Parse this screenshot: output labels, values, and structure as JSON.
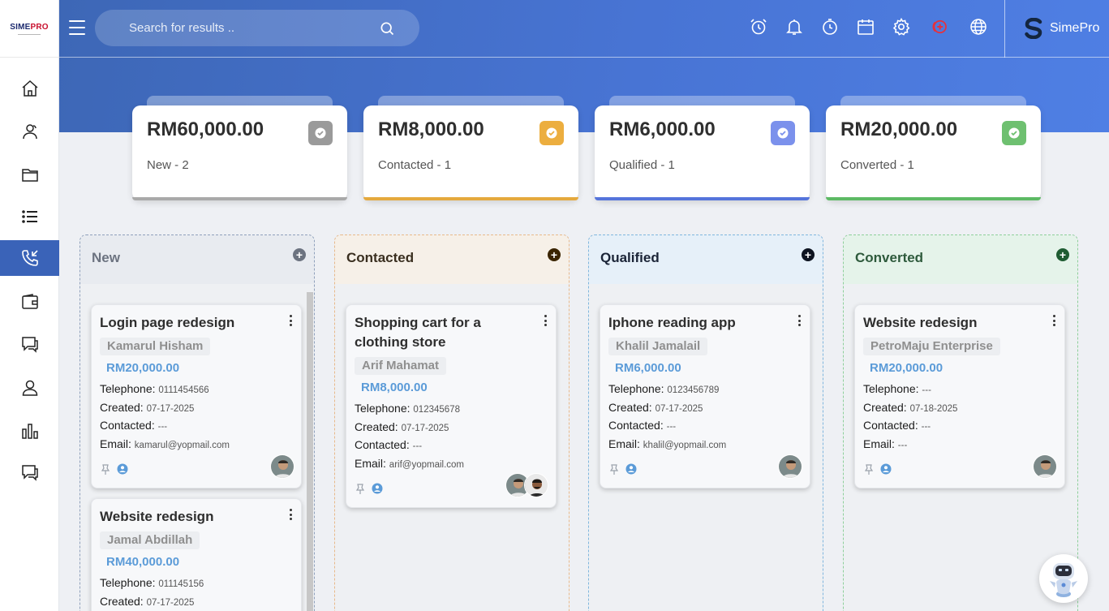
{
  "logo": {
    "text_a": "SIME",
    "text_b": "PRO"
  },
  "search": {
    "placeholder": "Search for results .."
  },
  "user": {
    "name": "SimePro"
  },
  "summary": [
    {
      "amount": "RM60,000.00",
      "label": "New - 2",
      "color": "#a9a9a9",
      "badge": "#9a9a9a"
    },
    {
      "amount": "RM8,000.00",
      "label": "Contacted - 1",
      "color": "#e5a93d",
      "badge": "#ecae3f"
    },
    {
      "amount": "RM6,000.00",
      "label": "Qualified - 1",
      "color": "#5574db",
      "badge": "#7b91ec"
    },
    {
      "amount": "RM20,000.00",
      "label": "Converted - 1",
      "color": "#5dba64",
      "badge": "#6ec070"
    }
  ],
  "columns": [
    {
      "title": "New",
      "title_color": "#6c7380"
    },
    {
      "title": "Contacted",
      "title_color": "#3a2f20"
    },
    {
      "title": "Qualified",
      "title_color": "#1b2437"
    },
    {
      "title": "Converted",
      "title_color": "#2e5a3c"
    }
  ],
  "field_labels": {
    "telephone": "Telephone:",
    "created": "Created:",
    "contacted": "Contacted:",
    "email": "Email:"
  },
  "cards": [
    {
      "title": "Login page redesign",
      "contact": "Kamarul Hisham",
      "amount": "RM20,000.00",
      "telephone": "0111454566",
      "created": "07-17-2025",
      "contacted": "---",
      "email": "kamarul@yopmail.com"
    },
    {
      "title": "Website redesign",
      "contact": "Jamal Abdillah",
      "amount": "RM40,000.00",
      "telephone": "011145156",
      "created": "07-17-2025"
    },
    {
      "title": "Shopping cart for a clothing store",
      "contact": "Arif Mahamat",
      "amount": "RM8,000.00",
      "telephone": "012345678",
      "created": "07-17-2025",
      "contacted": "---",
      "email": "arif@yopmail.com"
    },
    {
      "title": "Iphone reading app",
      "contact": "Khalil Jamalail",
      "amount": "RM6,000.00",
      "telephone": "0123456789",
      "created": "07-17-2025",
      "contacted": "---",
      "email": "khalil@yopmail.com"
    },
    {
      "title": "Website redesign",
      "contact": "PetroMaju Enterprise",
      "amount": "RM20,000.00",
      "telephone": "---",
      "created": "07-18-2025",
      "contacted": "---",
      "email": "---"
    }
  ],
  "icons": {
    "nav": [
      "home-icon",
      "contacts-icon",
      "folder-icon",
      "list-icon",
      "phone-incoming-icon",
      "wallet-icon",
      "chat-icon",
      "user-icon",
      "bar-chart-icon",
      "chat-icon"
    ],
    "top": [
      "alarm-clock-icon",
      "bell-icon",
      "timer-icon",
      "calendar-icon",
      "gear-icon",
      "add-circle-icon",
      "globe-icon"
    ]
  }
}
